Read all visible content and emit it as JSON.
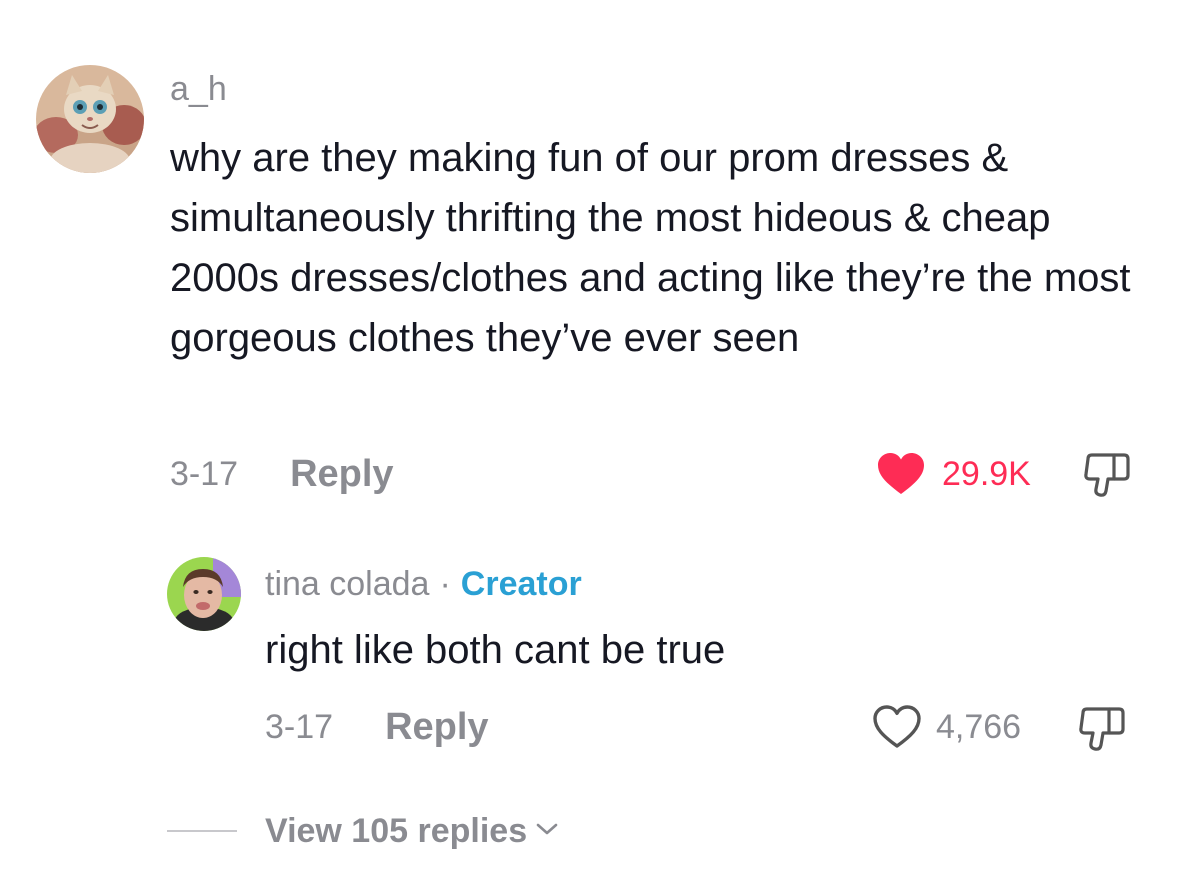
{
  "comment": {
    "username": "a_h",
    "text": "why are they making fun of our prom dresses & simultaneously thrifting the most hideous & cheap 2000s dresses/clothes and acting like they’re the most gorgeous clothes they’ve ever seen",
    "date": "3-17",
    "reply_label": "Reply",
    "like_count": "29.9K",
    "liked": true,
    "like_color": "#fe2c55",
    "icons": {
      "like": "heart-filled-icon",
      "dislike": "thumbs-down-icon"
    }
  },
  "reply": {
    "username": "tina colada",
    "separator": "·",
    "badge": "Creator",
    "badge_color": "#2aa0d4",
    "text": "right like both cant be true",
    "date": "3-17",
    "reply_label": "Reply",
    "like_count": "4,766",
    "liked": false,
    "icons": {
      "like": "heart-outline-icon",
      "dislike": "thumbs-down-icon"
    }
  },
  "view_replies": {
    "label": "View 105 replies",
    "icon": "chevron-down-icon"
  },
  "colors": {
    "text_primary": "#161823",
    "text_secondary": "#8a8b91",
    "accent_like": "#fe2c55"
  }
}
